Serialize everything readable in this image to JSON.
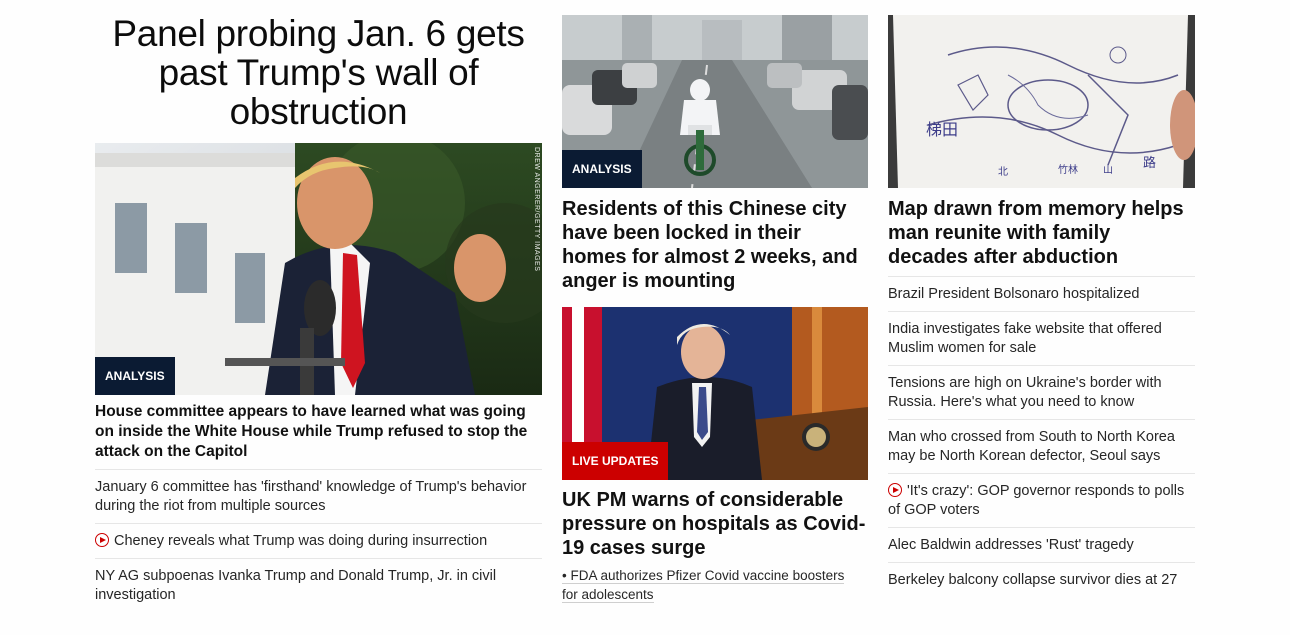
{
  "col1": {
    "lead_title": "Panel probing Jan. 6 gets past Trump's wall of obstruction",
    "image_alt": "Donald Trump speaking to reporters outside the White House",
    "photo_credit": "DREW ANGERER/GETTY IMAGES",
    "badge": "ANALYSIS",
    "headline": "House committee appears to have learned what was going on inside the White House while Trump refused to stop the attack on the Capitol",
    "links": [
      {
        "text": "January 6 committee has 'firsthand' knowledge of Trump's behavior during the riot from multiple sources",
        "video": false
      },
      {
        "text": "Cheney reveals what Trump was doing during insurrection",
        "video": true
      },
      {
        "text": "NY AG subpoenas Ivanka Trump and Donald Trump, Jr. in civil investigation",
        "video": false
      }
    ]
  },
  "col2": {
    "story1": {
      "badge": "ANALYSIS",
      "headline": "Residents of this Chinese city have been locked in their homes for almost 2 weeks, and anger is mounting"
    },
    "story2": {
      "badge": "LIVE UPDATES",
      "headline": "UK PM warns of considerable pressure on hospitals as Covid-19 cases surge",
      "sub_link": "• FDA authorizes Pfizer Covid vaccine boosters for adolescents"
    }
  },
  "col3": {
    "headline": "Map drawn from memory helps man reunite with family decades after abduction",
    "links": [
      {
        "text": "Brazil President Bolsonaro hospitalized",
        "video": false
      },
      {
        "text": "India investigates fake website that offered Muslim women for sale",
        "video": false
      },
      {
        "text": "Tensions are high on Ukraine's border with Russia. Here's what you need to know",
        "video": false
      },
      {
        "text": "Man who crossed from South to North Korea may be North Korean defector, Seoul says",
        "video": false
      },
      {
        "text": "'It's crazy': GOP governor responds to polls of GOP voters",
        "video": true
      },
      {
        "text": "Alec Baldwin addresses 'Rust' tragedy",
        "video": false
      },
      {
        "text": "Berkeley balcony collapse survivor dies at 27",
        "video": false
      }
    ],
    "map_labels": [
      "梯田",
      "北",
      "竹林",
      "路",
      "山"
    ]
  },
  "colors": {
    "badge_dark": "#0b1b33",
    "badge_red": "#cc0000",
    "text": "#0c0c0c",
    "divider": "#e6e6e6"
  }
}
